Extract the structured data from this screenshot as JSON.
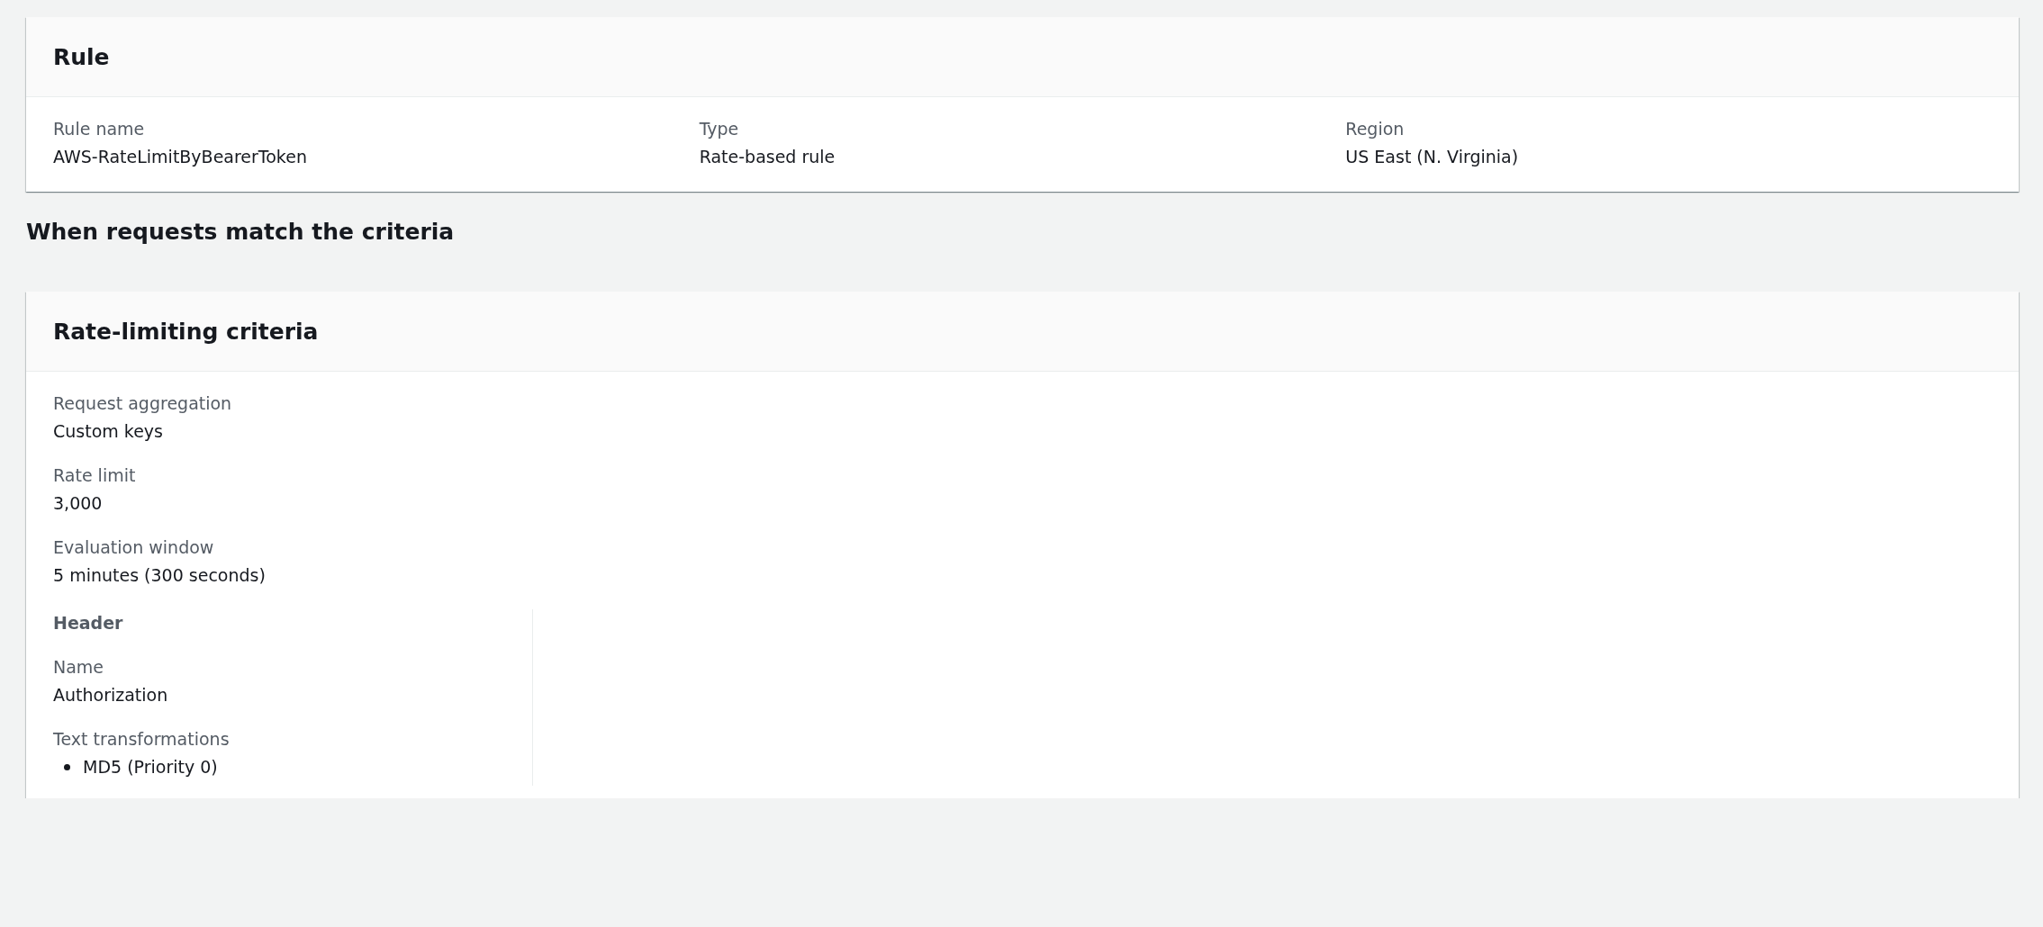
{
  "rule_card": {
    "title": "Rule",
    "fields": [
      {
        "label": "Rule name",
        "value": "AWS-RateLimitByBearerToken"
      },
      {
        "label": "Type",
        "value": "Rate-based rule"
      },
      {
        "label": "Region",
        "value": "US East (N. Virginia)"
      }
    ]
  },
  "section_heading": "When requests match the criteria",
  "criteria_card": {
    "title": "Rate-limiting criteria",
    "fields": [
      {
        "label": "Request aggregation",
        "value": "Custom keys"
      },
      {
        "label": "Rate limit",
        "value": "3,000"
      },
      {
        "label": "Evaluation window",
        "value": "5 minutes (300 seconds)"
      }
    ],
    "keys": [
      {
        "type": "Header",
        "name_label": "Name",
        "name": "Authorization",
        "transformations_label": "Text transformations",
        "transformations": [
          "MD5 (Priority 0)"
        ]
      }
    ]
  }
}
